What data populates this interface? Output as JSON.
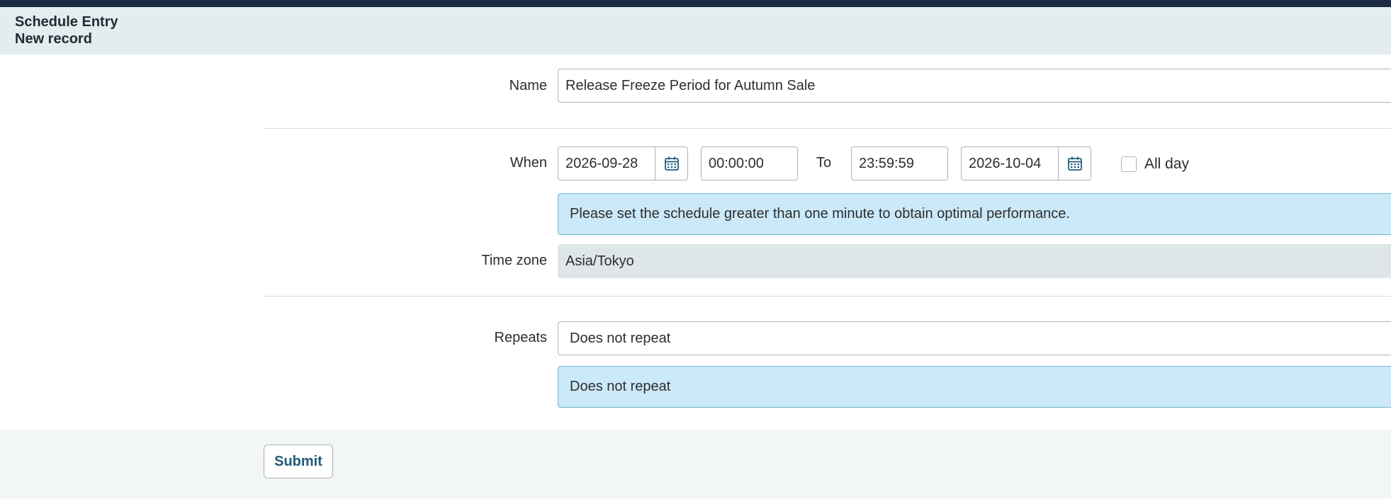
{
  "header": {
    "title": "Schedule Entry",
    "subtitle": "New record"
  },
  "form": {
    "name": {
      "label": "Name",
      "value": "Release Freeze Period for Autumn Sale"
    },
    "when": {
      "label": "When",
      "start_date": "2026-09-28",
      "start_time": "00:00:00",
      "to_label": "To",
      "end_time": "23:59:59",
      "end_date": "2026-10-04",
      "all_day_label": "All day",
      "all_day_checked": false
    },
    "info_message": "Please set the schedule greater than one minute to obtain optimal performance.",
    "timezone": {
      "label": "Time zone",
      "value": "Asia/Tokyo"
    },
    "repeats": {
      "label": "Repeats",
      "value": "Does not repeat",
      "summary": "Does not repeat"
    }
  },
  "actions": {
    "submit_label": "Submit"
  },
  "icons": {
    "date_picker": "calendar-icon"
  },
  "colors": {
    "topbar": "#1b2b42",
    "header_bg": "#e3ecee",
    "info_bg": "#cbe9f8",
    "accent": "#1e5c7a"
  }
}
